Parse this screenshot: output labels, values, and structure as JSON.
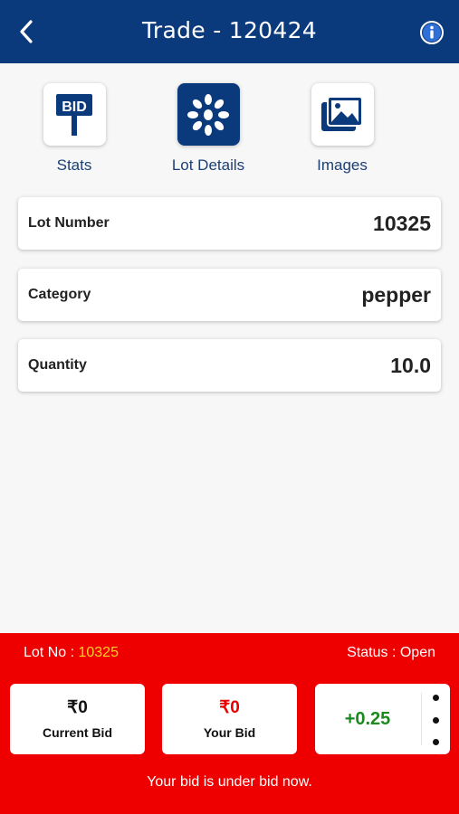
{
  "header": {
    "title": "Trade - 120424",
    "back_icon": "chevron-left-icon",
    "info_icon": "info-icon"
  },
  "tabs": [
    {
      "label": "Stats",
      "icon": "bid-sign-icon",
      "active": false
    },
    {
      "label": "Lot Details",
      "icon": "seeds-icon",
      "active": true
    },
    {
      "label": "Images",
      "icon": "images-icon",
      "active": false
    }
  ],
  "details": [
    {
      "label": "Lot Number",
      "value": "10325"
    },
    {
      "label": "Category",
      "value": "pepper"
    },
    {
      "label": "Quantity",
      "value": "10.0"
    }
  ],
  "footer": {
    "lot_prefix": "Lot No : ",
    "lot_number": "10325",
    "status": "Status : Open",
    "current_bid": {
      "amount": "₹0",
      "label": "Current Bid"
    },
    "your_bid": {
      "amount": "₹0",
      "label": "Your Bid"
    },
    "increment": "+0.25",
    "message": "Your bid is under bid now."
  },
  "colors": {
    "brand": "#0b3a7c",
    "footer": "#ee0000",
    "lot_highlight": "#ffd21f",
    "increment": "#1c8a1c"
  }
}
